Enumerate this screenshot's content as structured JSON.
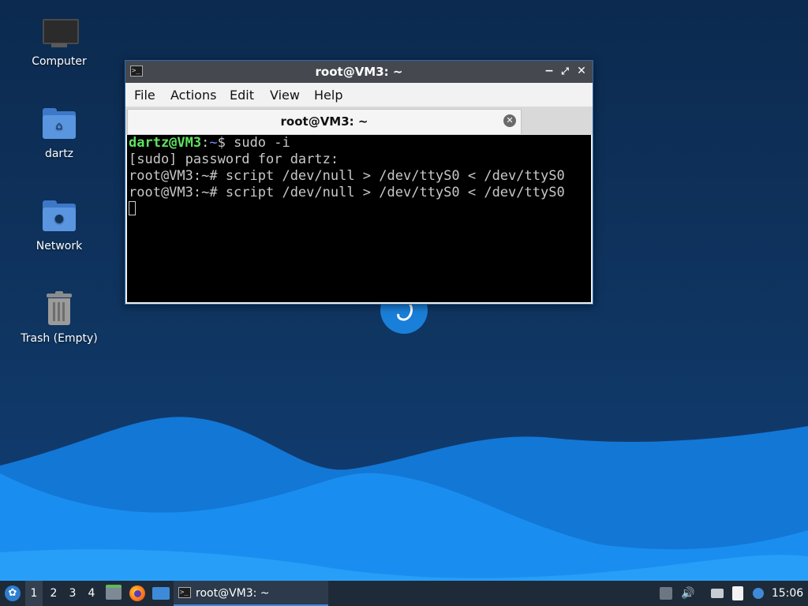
{
  "desktop": {
    "icons": [
      {
        "label": "Computer"
      },
      {
        "label": "dartz"
      },
      {
        "label": "Network"
      },
      {
        "label": "Trash (Empty)"
      }
    ]
  },
  "window": {
    "title": "root@VM3: ~",
    "buttons": {
      "minimize": "−",
      "maximize": "⤢",
      "close": "✕"
    },
    "menu": [
      "File",
      "Actions",
      "Edit",
      "View",
      "Help"
    ],
    "tab": {
      "label": "root@VM3: ~",
      "close": "✕"
    },
    "terminal": {
      "line1": {
        "user": "dartz@VM3",
        "sep": ":",
        "path": "~",
        "cmd": "$ sudo -i"
      },
      "line2": "[sudo] password for dartz:",
      "line3": "root@VM3:~# script /dev/null > /dev/ttyS0 < /dev/ttyS0",
      "line4": "root@VM3:~# script /dev/null > /dev/ttyS0 < /dev/ttyS0"
    }
  },
  "taskbar": {
    "workspaces": [
      "1",
      "2",
      "3",
      "4"
    ],
    "active_workspace": "1",
    "task": {
      "label": "root@VM3: ~"
    },
    "clock": "15:06"
  },
  "colors": {
    "accent": "#3e8ad9",
    "titlebar": "#45494f",
    "taskbar": "#1f2a38",
    "prompt_user": "#5fe35f",
    "prompt_path": "#6f8cff"
  }
}
